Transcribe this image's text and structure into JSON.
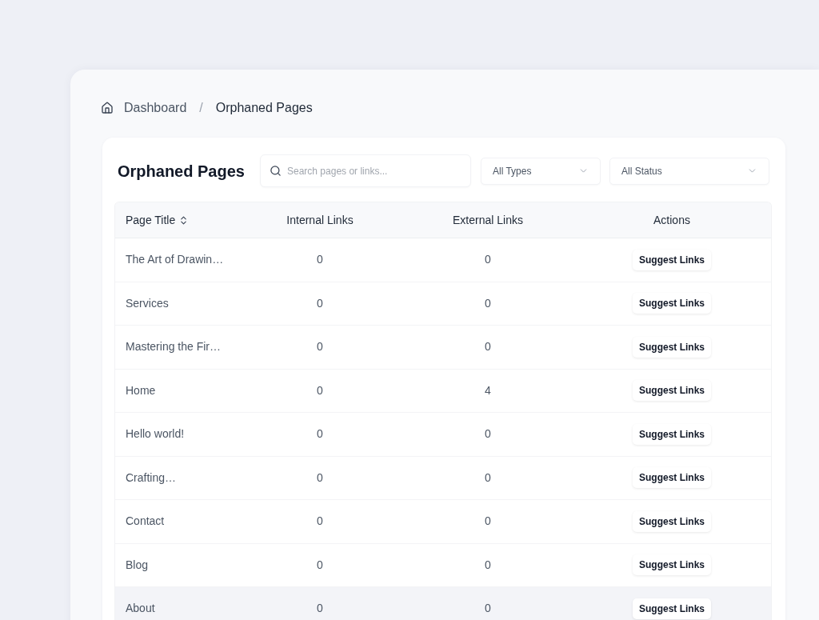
{
  "breadcrumb": {
    "items": [
      {
        "label": "Dashboard",
        "kind": "link"
      },
      {
        "label": "Orphaned Pages",
        "kind": "current"
      }
    ],
    "separator": "/"
  },
  "card": {
    "title": "Orphaned Pages",
    "search": {
      "placeholder": "Search pages or links..."
    },
    "filters": [
      {
        "value": "All Types"
      },
      {
        "value": "All Status"
      }
    ],
    "table": {
      "columns": [
        {
          "label": "Page Title",
          "sortable": true
        },
        {
          "label": "Internal Links",
          "sortable": false
        },
        {
          "label": "External Links",
          "sortable": false
        },
        {
          "label": "Actions",
          "sortable": false
        }
      ],
      "rows": [
        {
          "title": "The Art of Drawin…",
          "internal_links": "0",
          "external_links": "0",
          "action": "Suggest Links",
          "selected": false
        },
        {
          "title": "Services",
          "internal_links": "0",
          "external_links": "0",
          "action": "Suggest Links",
          "selected": false
        },
        {
          "title": "Mastering the Fir…",
          "internal_links": "0",
          "external_links": "0",
          "action": "Suggest Links",
          "selected": false
        },
        {
          "title": "Home",
          "internal_links": "0",
          "external_links": "4",
          "action": "Suggest Links",
          "selected": false
        },
        {
          "title": "Hello world!",
          "internal_links": "0",
          "external_links": "0",
          "action": "Suggest Links",
          "selected": false
        },
        {
          "title": "Crafting…",
          "internal_links": "0",
          "external_links": "0",
          "action": "Suggest Links",
          "selected": false
        },
        {
          "title": "Contact",
          "internal_links": "0",
          "external_links": "0",
          "action": "Suggest Links",
          "selected": false
        },
        {
          "title": "Blog",
          "internal_links": "0",
          "external_links": "0",
          "action": "Suggest Links",
          "selected": false
        },
        {
          "title": "About",
          "internal_links": "0",
          "external_links": "0",
          "action": "Suggest Links",
          "selected": true
        }
      ]
    }
  }
}
